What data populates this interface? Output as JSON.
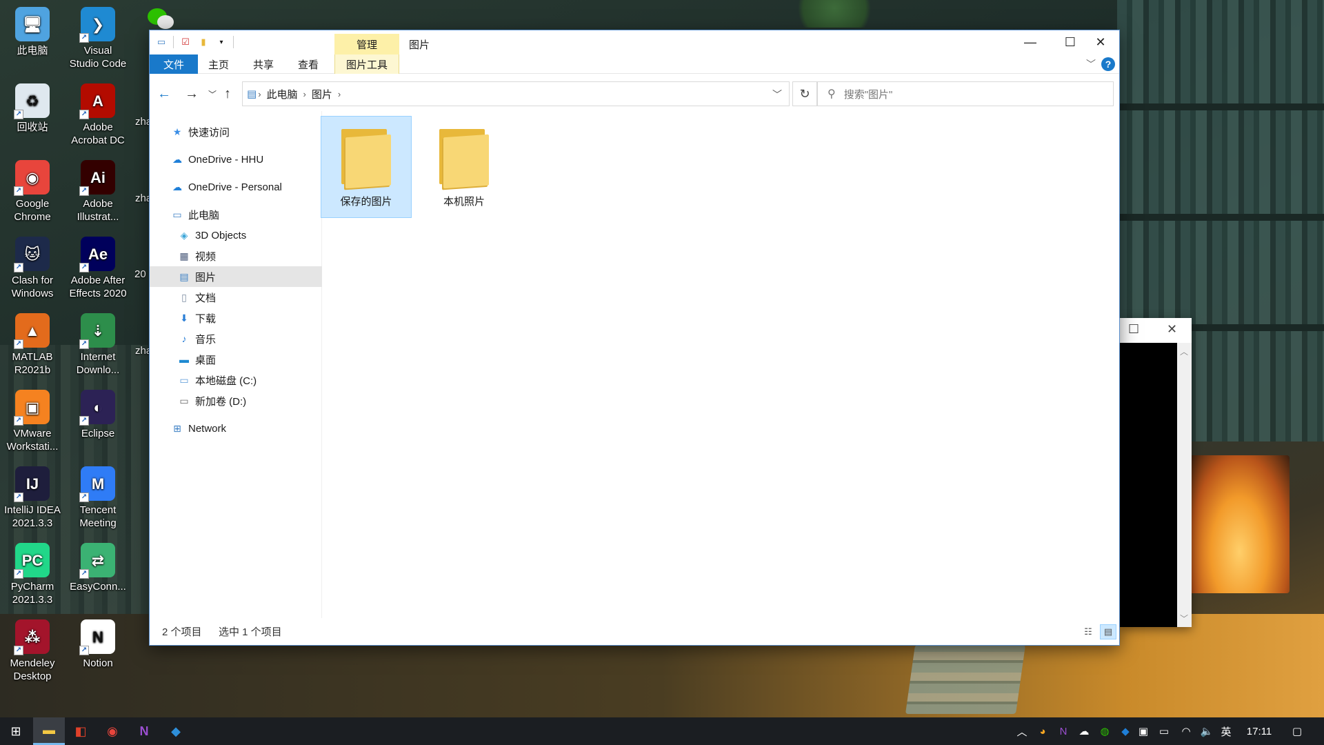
{
  "desktop": {
    "col1": [
      {
        "label1": "此电脑",
        "label2": "",
        "icon": "computer-icon",
        "color": "#4fa3e0",
        "glyph": "🖥"
      },
      {
        "label1": "回收站",
        "label2": "",
        "icon": "recycle-bin-icon",
        "color": "#dfe8ef",
        "glyph": "♻"
      },
      {
        "label1": "Google",
        "label2": "Chrome",
        "icon": "chrome-icon",
        "color": "#e8453c",
        "glyph": "◉"
      },
      {
        "label1": "Clash for",
        "label2": "Windows",
        "icon": "clash-icon",
        "color": "#1d2a4a",
        "glyph": "🐱"
      },
      {
        "label1": "MATLAB",
        "label2": "R2021b",
        "icon": "matlab-icon",
        "color": "#e36b1c",
        "glyph": "▲"
      },
      {
        "label1": "VMware",
        "label2": "Workstati...",
        "icon": "vmware-icon",
        "color": "#f58220",
        "glyph": "▣"
      },
      {
        "label1": "IntelliJ IDEA",
        "label2": "2021.3.3",
        "icon": "intellij-icon",
        "color": "#1e1e3c",
        "glyph": "IJ"
      },
      {
        "label1": "PyCharm",
        "label2": "2021.3.3",
        "icon": "pycharm-icon",
        "color": "#21d789",
        "glyph": "PC"
      },
      {
        "label1": "Mendeley",
        "label2": "Desktop",
        "icon": "mendeley-icon",
        "color": "#a3142b",
        "glyph": "⁂"
      }
    ],
    "col2": [
      {
        "label1": "Visual",
        "label2": "Studio Code",
        "icon": "vscode-icon",
        "color": "#1f8ad2",
        "glyph": "❯"
      },
      {
        "label1": "Adobe",
        "label2": "Acrobat DC",
        "icon": "acrobat-icon",
        "color": "#b30b00",
        "glyph": "A"
      },
      {
        "label1": "Adobe",
        "label2": "Illustrat...",
        "icon": "illustrator-icon",
        "color": "#330000",
        "glyph": "Ai"
      },
      {
        "label1": "Adobe After",
        "label2": "Effects 2020",
        "icon": "after-effects-icon",
        "color": "#00005b",
        "glyph": "Ae"
      },
      {
        "label1": "Internet",
        "label2": "Downlo...",
        "icon": "idm-icon",
        "color": "#2d8e4b",
        "glyph": "⇣"
      },
      {
        "label1": "Eclipse",
        "label2": "",
        "icon": "eclipse-icon",
        "color": "#2c2255",
        "glyph": "◐"
      },
      {
        "label1": "Tencent",
        "label2": "Meeting",
        "icon": "tencent-meeting-icon",
        "color": "#2f7cf6",
        "glyph": "M"
      },
      {
        "label1": "EasyConn...",
        "label2": "",
        "icon": "easyconnect-icon",
        "color": "#3bb273",
        "glyph": "⇄"
      },
      {
        "label1": "Notion",
        "label2": "",
        "icon": "notion-icon",
        "color": "#ffffff",
        "glyph": "N"
      }
    ],
    "partial": [
      "zha",
      "zha",
      "20",
      "zha"
    ]
  },
  "window": {
    "title": "图片",
    "manage_tab": "管理",
    "ribbon_tabs": [
      "文件",
      "主页",
      "共享",
      "查看",
      "图片工具"
    ],
    "help": "?",
    "breadcrumb": [
      "此电脑",
      "图片"
    ],
    "search_placeholder": "搜索\"图片\"",
    "sidebar": [
      {
        "label": "快速访问",
        "icon": "star-icon",
        "glyph": "★",
        "color": "#3a8ee6"
      },
      {
        "label": "OneDrive - HHU",
        "icon": "cloud-icon",
        "glyph": "☁",
        "color": "#1f7fd8"
      },
      {
        "label": "OneDrive - Personal",
        "icon": "cloud-icon",
        "glyph": "☁",
        "color": "#1f7fd8"
      },
      {
        "label": "此电脑",
        "icon": "computer-icon",
        "glyph": "▭",
        "color": "#3b7fc4"
      },
      {
        "label": "3D Objects",
        "icon": "cube-icon",
        "glyph": "◈",
        "color": "#3ba5d8"
      },
      {
        "label": "视频",
        "icon": "video-icon",
        "glyph": "▦",
        "color": "#4a5a7a"
      },
      {
        "label": "图片",
        "icon": "pictures-icon",
        "glyph": "▤",
        "color": "#3b7fc4"
      },
      {
        "label": "文档",
        "icon": "document-icon",
        "glyph": "▯",
        "color": "#7a8aa0"
      },
      {
        "label": "下载",
        "icon": "download-icon",
        "glyph": "⬇",
        "color": "#2a7ed6"
      },
      {
        "label": "音乐",
        "icon": "music-icon",
        "glyph": "♪",
        "color": "#2a7ed6"
      },
      {
        "label": "桌面",
        "icon": "desktop-icon",
        "glyph": "▬",
        "color": "#1f8ad2"
      },
      {
        "label": "本地磁盘 (C:)",
        "icon": "drive-c-icon",
        "glyph": "▭",
        "color": "#5a9ad8"
      },
      {
        "label": "新加卷 (D:)",
        "icon": "drive-d-icon",
        "glyph": "▭",
        "color": "#666666"
      },
      {
        "label": "Network",
        "icon": "network-icon",
        "glyph": "⊞",
        "color": "#3b7fc4"
      }
    ],
    "selected_sidebar": "图片",
    "items": [
      {
        "label": "保存的图片",
        "selected": true
      },
      {
        "label": "本机照片",
        "selected": false
      }
    ],
    "status_count": "2 个项目",
    "status_selected": "选中 1 个项目"
  },
  "taskbar": {
    "apps": [
      "start-icon",
      "file-explorer-icon",
      "office-icon",
      "chrome-icon",
      "onenote-icon",
      "sourcetree-icon"
    ],
    "tray_input": "英",
    "clock": "17:11"
  },
  "colors": {
    "accent": "#1979ca",
    "selection": "#cce8ff",
    "manage_tab": "#fdf0a8",
    "taskbar": "#1b1e22"
  }
}
